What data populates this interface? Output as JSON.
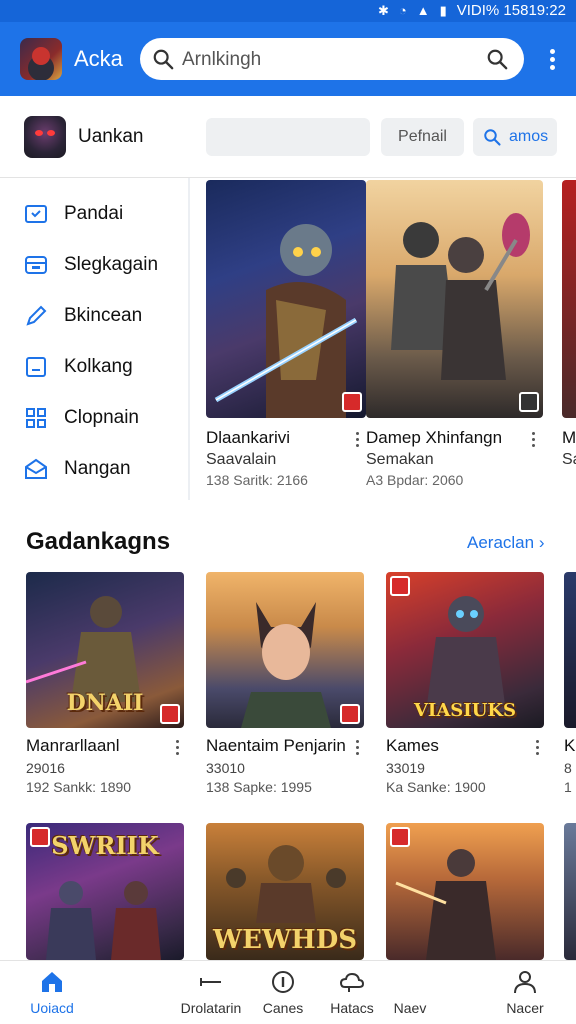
{
  "status_bar": {
    "time_text": "VIDI% 15819:22"
  },
  "app_bar": {
    "app_name": "Acka",
    "search_text": "Arnlkingh"
  },
  "profile": {
    "name": "Uankan",
    "button_1": "Pefnail",
    "button_2": "amos"
  },
  "sidebar": {
    "items": [
      {
        "label": "Pandai",
        "icon": "tv-icon"
      },
      {
        "label": "Slegkagain",
        "icon": "inbox-icon"
      },
      {
        "label": "Bkincean",
        "icon": "pencil-icon"
      },
      {
        "label": "Kolkang",
        "icon": "window-icon"
      },
      {
        "label": "Clopnain",
        "icon": "puzzle-icon"
      },
      {
        "label": "Nangan",
        "icon": "mail-icon"
      }
    ]
  },
  "featured": [
    {
      "title": "Dlaankarivi",
      "subtitle": "Saavalain",
      "meta": "138 Saritk: 2166"
    },
    {
      "title": "Damep Xhinfangn",
      "subtitle": "Semakan",
      "meta": "A3 Bpdar: 2060"
    },
    {
      "title": "M",
      "subtitle": "Sa",
      "meta": ""
    }
  ],
  "section": {
    "title": "Gadankagns",
    "link": "Aeraclan ›"
  },
  "grid_row_1": [
    {
      "title": "Manrarllaanl",
      "subtitle": "29016",
      "meta": "192 Sankk: 1890",
      "art_text": "DNAII"
    },
    {
      "title": "Naentaim Penjarin",
      "subtitle": "33010",
      "meta": "138 Sapke: 1995",
      "art_text": ""
    },
    {
      "title": "Kames",
      "subtitle": "33019",
      "meta": "Ka Sanke: 1900",
      "art_text": "VIASIUKS"
    },
    {
      "title": "K",
      "subtitle": "8",
      "meta": "1",
      "art_text": ""
    }
  ],
  "grid_row_2": [
    {
      "art_text": "SWRIIK"
    },
    {
      "art_text": "WEWHDS"
    },
    {
      "art_text": ""
    },
    {
      "art_text": ""
    }
  ],
  "bottom_nav": [
    {
      "label": "Uoiacd",
      "icon": "home-icon",
      "active": true
    },
    {
      "label": "Drolatarin",
      "icon": "line-icon",
      "active": false
    },
    {
      "label": "Canes",
      "icon": "info-icon",
      "active": false
    },
    {
      "label": "Hatacs",
      "icon": "cloud-icon",
      "active": false
    },
    {
      "label": "Naev",
      "icon": "",
      "active": false
    },
    {
      "label": "Nacer",
      "icon": "person-icon",
      "active": false
    }
  ],
  "colors": {
    "primary": "#1e73e8",
    "status_bar": "#1565d8",
    "badge_red": "#d62a2a"
  }
}
